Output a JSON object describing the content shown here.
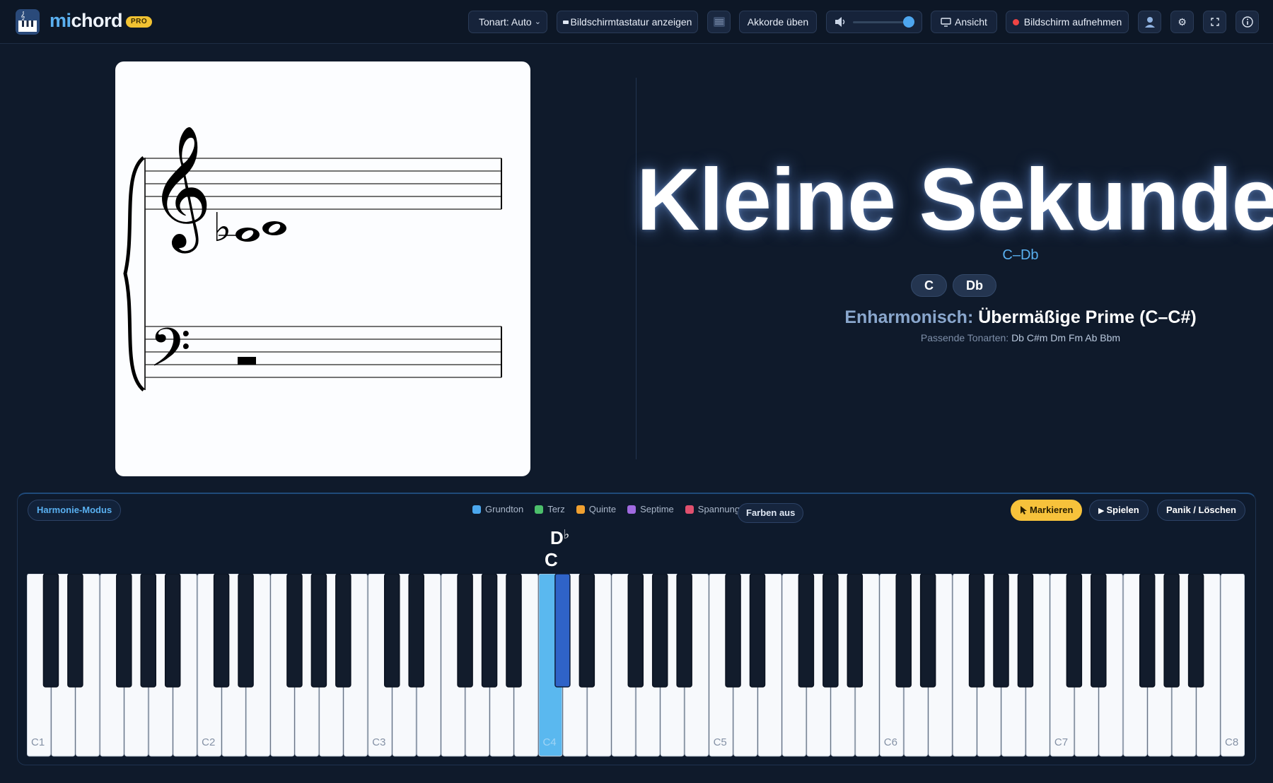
{
  "app": {
    "brand_part1": "mi",
    "brand_part2": "chord",
    "badge": "PRO"
  },
  "toolbar": {
    "key_select": "Tonart: Auto",
    "onscreen_keyboard": "Bildschirmtastatur anzeigen",
    "practice_chords": "Akkorde üben",
    "volume_percent": 85,
    "view": "Ansicht",
    "record_screen": "Bildschirm aufnehmen"
  },
  "interval": {
    "name": "Kleine Sekunde",
    "notes_line": "C–Db",
    "notes": [
      "C",
      "Db"
    ],
    "enharmonic_label": "Enharmonisch:",
    "enharmonic_value": "Übermäßige Prime (C–C#)",
    "keys_label": "Passende Tonarten:",
    "keys_value": "Db C#m Dm Fm Ab Bbm"
  },
  "piano_panel": {
    "mode_button": "Harmonie-Modus",
    "legend": [
      {
        "label": "Grundton",
        "color": "#4ba7ee"
      },
      {
        "label": "Terz",
        "color": "#4cbf6b"
      },
      {
        "label": "Quinte",
        "color": "#f0a030"
      },
      {
        "label": "Septime",
        "color": "#a06ae0"
      },
      {
        "label": "Spannung",
        "color": "#e0506e"
      }
    ],
    "colors_off": "Farben aus",
    "mark_button": "Markieren",
    "play_button": "Spielen",
    "panic_button": "Panik / Löschen",
    "float_label_root": "C",
    "float_label_second": "D",
    "float_label_second_accidental": "♭",
    "octave_labels": [
      "C1",
      "C2",
      "C3",
      "C4",
      "C5",
      "C6",
      "C7",
      "C8"
    ],
    "highlighted_white_key": "C4",
    "highlighted_black_key": "Db4"
  },
  "colors": {
    "accent": "#4ba7ee",
    "highlight_white": "#5ab8ef",
    "highlight_black": "#2f63c8",
    "mark_yellow": "#f7c23b"
  }
}
